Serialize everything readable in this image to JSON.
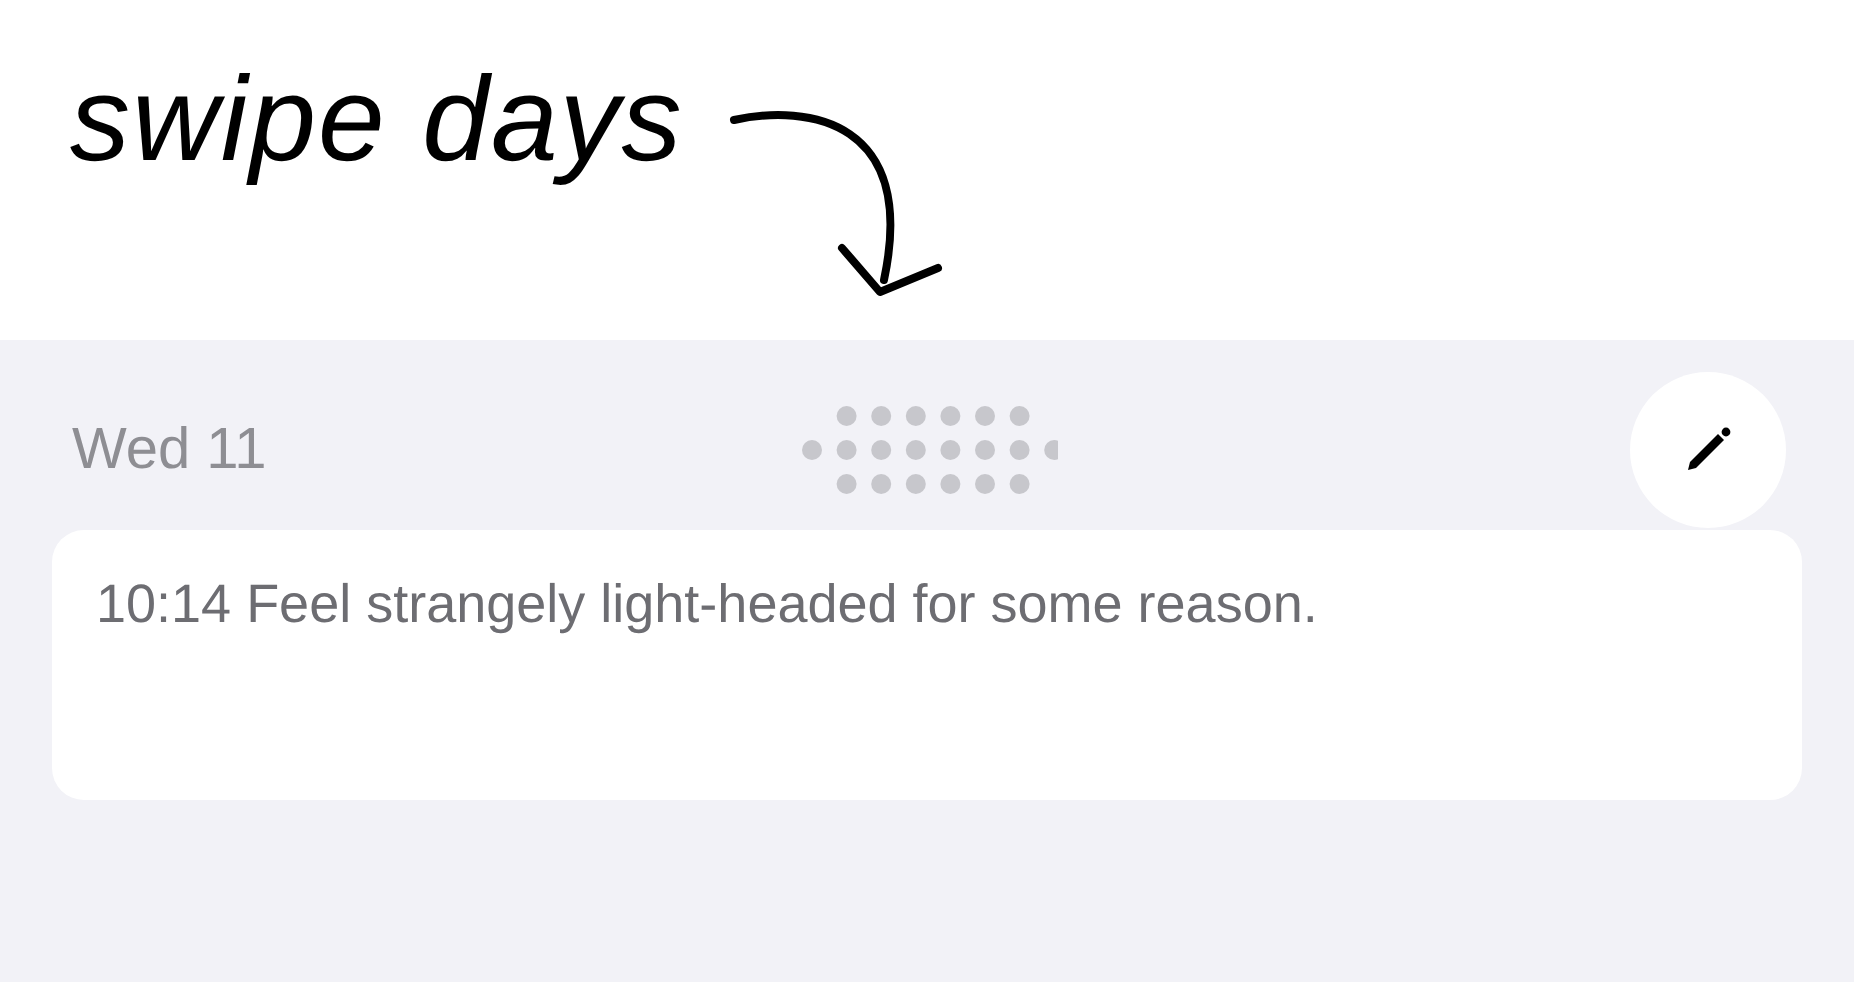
{
  "annotation": {
    "text": "swipe days"
  },
  "day": {
    "title": "Wed 11"
  },
  "entries": [
    {
      "text": "10:14 Feel strangely light-headed for some reason."
    }
  ]
}
